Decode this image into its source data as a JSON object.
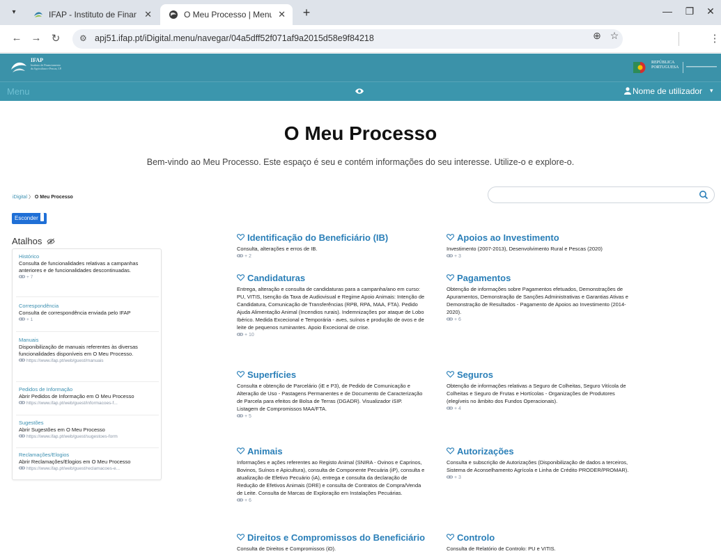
{
  "browser": {
    "tabs": [
      {
        "title": "IFAP - Instituto de Financiamen",
        "active": false
      },
      {
        "title": "O Meu Processo | Menu",
        "active": true
      }
    ],
    "url": "apj51.ifap.pt/iDigital.menu/navegar/04a5dff52f071af9a2015d58e9f84218"
  },
  "header": {
    "logo": {
      "name": "IFAP",
      "line1": "Instituto de Financiamento",
      "line2": "da Agricultura e Pescas, I.P."
    },
    "gov_logo": {
      "line1": "REPÚBLICA",
      "line2": "PORTUGUESA"
    },
    "menu_label": "Menu",
    "user_label": "Nome de utilizador"
  },
  "main": {
    "title": "O Meu Processo",
    "intro": "Bem-vindo ao Meu Processo. Este espaço é seu e contém informações do seu interesse. Utilize-o e explore-o.",
    "breadcrumb": {
      "root": "iDigital",
      "sep": "〉",
      "current": "O Meu Processo"
    },
    "search": {
      "placeholder": "",
      "value": ""
    },
    "hide_button": "Esconder",
    "shortcuts_title": "Atalhos"
  },
  "shortcuts": [
    {
      "title": "Histórico",
      "desc": "Consulta de funcionalidades relativas a campanhas anteriores e de funcionalidades descontinuadas.",
      "meta": "+ 7"
    },
    {
      "title": "Correspondência",
      "desc": "Consulta de correspondência enviada pelo IFAP",
      "meta": "+ 1"
    },
    {
      "title": "Manuais",
      "desc": "Disponibilização de manuais referentes às diversas funcionalidades disponíveis em O Meu Processo.",
      "meta": "https://www.ifap.pt/web/guest/manuais"
    },
    {
      "title": "Pedidos de Informação",
      "desc": "Abrir Pedidos de Informação em O Meu Processo",
      "meta": "https://www.ifap.pt/web/guest/informacoes-f..."
    },
    {
      "title": "Sugestões",
      "desc": "Abrir Sugestões em O Meu Processo",
      "meta": "https://www.ifap.pt/web/guest/sugestoes-form"
    },
    {
      "title": "Reclamações/Elogios",
      "desc": "Abrir Reclamações/Elogios em O Meu Processo",
      "meta": "https://www.ifap.pt/web/guest/reclamacoes-e..."
    }
  ],
  "cards": [
    {
      "title": "Identificação do Beneficiário (IB)",
      "desc": "Consulta, alterações e erros de IB.",
      "meta": "+ 2"
    },
    {
      "title": "Apoios ao Investimento",
      "desc": "Investimento (2007-2013), Desenvolvimento Rural e Pescas (2020)",
      "meta": "+ 3"
    },
    {
      "title": "Candidaturas",
      "desc": "Entrega, alteração e consulta de candidaturas para a campanha/ano em curso: PU, VITIS, Isenção da Taxa de Audiovisual e Regime Apoio Animais: Intenção de Candidatura, Comunicação de Transferências (RPB, RPA, MAA, FTA). Pedido Ajuda Alimentação Animal (Incendios rurais). Indemnizações por ataque de Lobo Ibérico. Medida Excecional e Temporária - aves, suínos e produção de ovos e de leite de pequenos ruminantes. Apoio Excecional de crise.",
      "meta": "+ 10"
    },
    {
      "title": "Pagamentos",
      "desc": "Obtenção de informações sobre Pagamentos efetuados, Demonstrações de Apuramentos, Demonstração de Sanções Administrativas e Garantias Ativas e Demonstração de Resultados - Pagamento de Apoios ao Investimento (2014-2020).",
      "meta": "+ 6"
    },
    {
      "title": "Superfícies",
      "desc": "Consulta e obtenção de Parcelário (iE e P3), de Pedido de Comunicação e Alteração de Uso - Pastagens Permanentes e de Documento de Caracterização de Parcela para efeitos de Bolsa de Terras (DGADR). Visualizador iSIP. Listagem de Compromissos MAA/FTA.",
      "meta": "+ 5"
    },
    {
      "title": "Seguros",
      "desc": "Obtenção de informações relativas a Seguro de Colheitas, Seguro Vitícola de Colheitas e Seguro de Frutas e Hortícolas - Organizações de Produtores (elegíveis no âmbito dos Fundos Operacionais).",
      "meta": "+ 4"
    },
    {
      "title": "Animais",
      "desc": "Informações e ações referentes ao Registo Animal (SNIRA - Ovinos e Caprinos, Bovinos, Suínos e Apicultura), consulta de Componente Pecuária (iP), consulta e atualização de Efetivo Pecuário (iA), entrega e consulta da declaração de Redução de Efetivos Animais (DRE) e consulta de Contratos de Compra/Venda de Leite. Consulta de Marcas de Exploração em Instalações Pecuárias.",
      "meta": "+ 6"
    },
    {
      "title": "Autorizações",
      "desc": "Consulta e subscrição de Autorizações (Disponibilização de dados a terceiros, Sistema de Aconselhamento Agrícola e Linha de Crédito PRODER/PROMAR).",
      "meta": "+ 3"
    },
    {
      "title": "Direitos e Compromissos do Beneficiário",
      "desc": "Consulta de Direitos e Compromissos (iD).",
      "meta": ""
    },
    {
      "title": "Controlo",
      "desc": "Consulta de Relatório de Controlo: PU e VITIS.",
      "meta": ""
    }
  ],
  "colors": {
    "header_bg": "#3b96ad",
    "card_title": "#2a7fb8",
    "shortcut_title": "#3b8fb0",
    "hide_button": "#1f6fd6"
  },
  "icons": {
    "tab_favicon_1": "ifap-favicon",
    "tab_favicon_2": "globe-favicon",
    "card_icon": "heart-outline-icon",
    "link_icon": "link-icon",
    "search_icon": "search-icon",
    "hide_icon": "eye-slash-icon",
    "menu_eye": "eye-icon",
    "user_icon": "person-icon"
  }
}
